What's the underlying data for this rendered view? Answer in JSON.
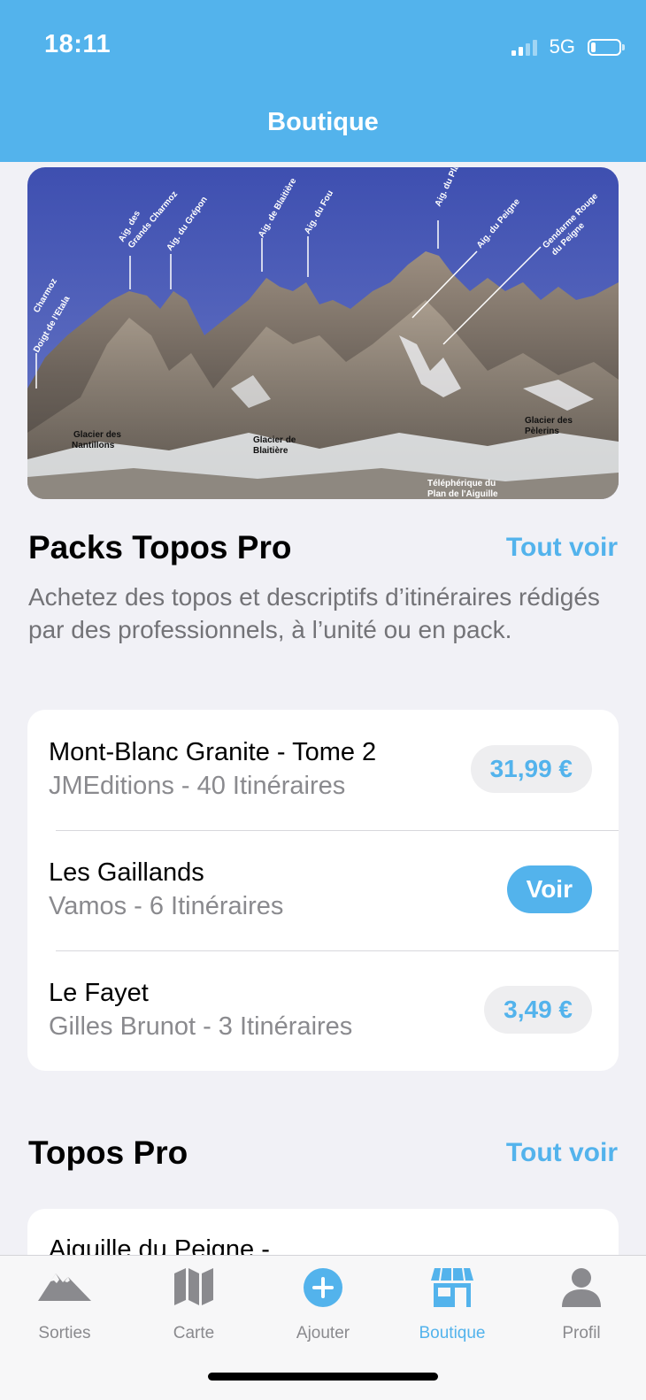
{
  "status_bar": {
    "time": "18:11",
    "network": "5G"
  },
  "header": {
    "title": "Boutique"
  },
  "hero": {
    "labels": [
      "Charmoz",
      "Doigt de l'Etala",
      "Aig. des Grands Charmoz",
      "Aig. du Grépon",
      "Aig. de Blaitière",
      "Aig. du Fou",
      "Aig. du Plan",
      "Aig. du Peigne",
      "Gendarme Rouge du Peigne",
      "Glacier des Nantillons",
      "Glacier de Blaitière",
      "Glacier des Pèlerins",
      "Téléphérique du Plan de l'Aiguille"
    ]
  },
  "packs": {
    "title": "Packs Topos Pro",
    "see_all": "Tout voir",
    "description": "Achetez des topos et descriptifs d’itinéraires rédigés par des professionnels, à l’unité ou en pack.",
    "items": [
      {
        "title": "Mont-Blanc Granite - Tome 2",
        "subtitle": "JMEditions - 40 Itinéraires",
        "action": "31,99 €"
      },
      {
        "title": "Les Gaillands",
        "subtitle": "Vamos - 6 Itinéraires",
        "action": "Voir"
      },
      {
        "title": "Le Fayet",
        "subtitle": "Gilles Brunot - 3 Itinéraires",
        "action": "3,49 €"
      }
    ]
  },
  "topos": {
    "title": "Topos Pro",
    "see_all": "Tout voir",
    "items": [
      {
        "title": "Aiguille du Peigne -"
      }
    ]
  },
  "tabbar": {
    "items": [
      {
        "label": "Sorties",
        "icon": "mountain-icon"
      },
      {
        "label": "Carte",
        "icon": "map-icon"
      },
      {
        "label": "Ajouter",
        "icon": "plus-circle-icon"
      },
      {
        "label": "Boutique",
        "icon": "store-icon"
      },
      {
        "label": "Profil",
        "icon": "person-icon"
      }
    ]
  },
  "colors": {
    "accent": "#53B3EC",
    "background": "#F1F1F6"
  }
}
